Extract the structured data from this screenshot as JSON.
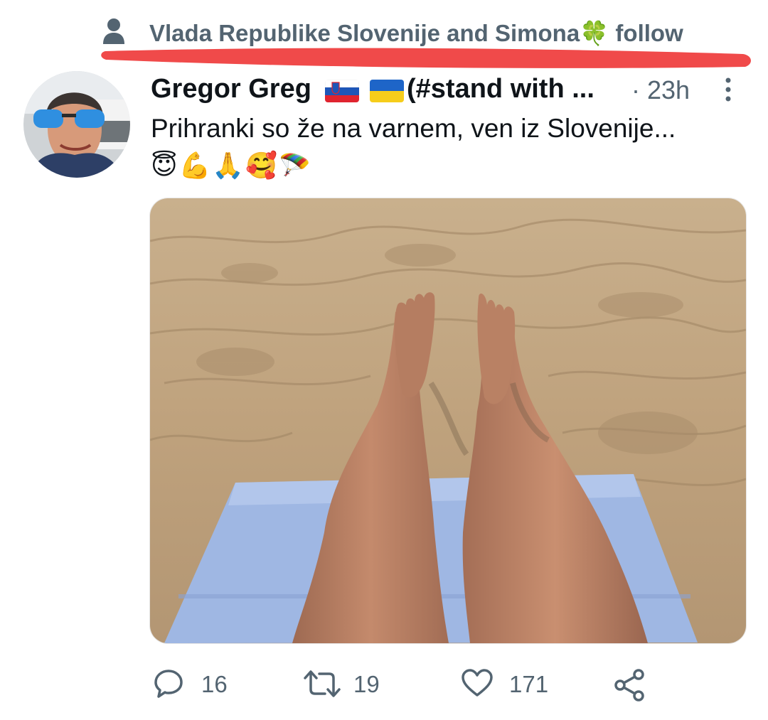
{
  "social_context": {
    "text": "Vlada Republike Slovenije and Simona🍀 follow",
    "icon": "person-icon"
  },
  "tweet": {
    "author_name": "Gregor Greg",
    "author_name_suffix": "(#stand with ...",
    "flags": [
      "slovenia-flag-icon",
      "ukraine-flag-icon"
    ],
    "time_separator": "·",
    "timestamp": "23h",
    "text": "Prihranki so že na varnem, ven iz Slovenije...",
    "emojis": "😇💪🙏🥰🪂",
    "media_alt": "Legs on a blue towel on the sand"
  },
  "actions": {
    "reply_count": "16",
    "retweet_count": "19",
    "like_count": "171"
  },
  "colors": {
    "secondary_text": "#536471",
    "primary_text": "#0f1419",
    "highlight_underline": "#f04a4a"
  }
}
